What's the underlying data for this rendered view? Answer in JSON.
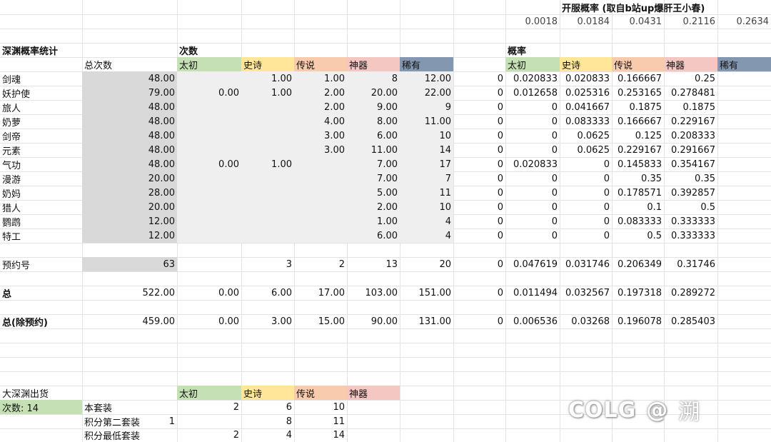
{
  "colors": {
    "grid": "#e3e3e3",
    "gray_block": "#d9d9d9",
    "light_block": "#efefef",
    "green": "#c5e0b4",
    "yellow": "#ffe699",
    "orange": "#f8cbad",
    "pink": "#f4c7c3",
    "blue_gray": "#8497b0"
  },
  "open_rate": {
    "title": "开服概率   (取自b站up爆肝王小春)",
    "values": [
      "0.0018",
      "0.0184",
      "0.0431",
      "0.2116",
      "0.2634"
    ]
  },
  "stats_title": "深渊概率统计",
  "count_title": "次数",
  "prob_title": "概率",
  "total_count_header": "总次数",
  "grade_headers": [
    "太初",
    "史诗",
    "传说",
    "神器",
    "稀有"
  ],
  "rows": [
    {
      "name": "剑魂",
      "total": "48.00",
      "counts": [
        "",
        "1.00",
        "1.00",
        "8",
        "12.00"
      ],
      "probs": [
        "0",
        "0.020833",
        "0.020833",
        "0.166667",
        "0.25"
      ]
    },
    {
      "name": "妖护使",
      "total": "79.00",
      "counts": [
        "0.00",
        "1.00",
        "2.00",
        "20.00",
        "22.00"
      ],
      "probs": [
        "0",
        "0.012658",
        "0.025316",
        "0.253165",
        "0.278481"
      ]
    },
    {
      "name": "旅人",
      "total": "48.00",
      "counts": [
        "",
        "",
        "2.00",
        "9.00",
        "9"
      ],
      "probs": [
        "0",
        "0",
        "0.041667",
        "0.1875",
        "0.1875"
      ]
    },
    {
      "name": "奶萝",
      "total": "48.00",
      "counts": [
        "",
        "",
        "4.00",
        "8.00",
        "11.00"
      ],
      "probs": [
        "0",
        "0",
        "0.083333",
        "0.166667",
        "0.229167"
      ]
    },
    {
      "name": "剑帝",
      "total": "48.00",
      "counts": [
        "",
        "",
        "3.00",
        "6.00",
        "10"
      ],
      "probs": [
        "0",
        "0",
        "0.0625",
        "0.125",
        "0.208333"
      ]
    },
    {
      "name": "元素",
      "total": "48.00",
      "counts": [
        "",
        "",
        "3.00",
        "11.00",
        "14"
      ],
      "probs": [
        "0",
        "0",
        "0.0625",
        "0.229167",
        "0.291667"
      ]
    },
    {
      "name": "气功",
      "total": "48.00",
      "counts": [
        "0.00",
        "1.00",
        "",
        "7.00",
        "17"
      ],
      "probs": [
        "0",
        "0.020833",
        "0",
        "0.145833",
        "0.354167"
      ]
    },
    {
      "name": "漫游",
      "total": "20.00",
      "counts": [
        "",
        "",
        "",
        "7.00",
        "7"
      ],
      "probs": [
        "0",
        "0",
        "0",
        "0.35",
        "0.35"
      ]
    },
    {
      "name": "奶妈",
      "total": "28.00",
      "counts": [
        "",
        "",
        "",
        "5.00",
        "11"
      ],
      "probs": [
        "0",
        "0",
        "0",
        "0.178571",
        "0.392857"
      ]
    },
    {
      "name": "猎人",
      "total": "20.00",
      "counts": [
        "",
        "",
        "",
        "2.00",
        "10"
      ],
      "probs": [
        "0",
        "0",
        "0",
        "0.1",
        "0.5"
      ]
    },
    {
      "name": "鹦鹉",
      "total": "12.00",
      "counts": [
        "",
        "",
        "",
        "1.00",
        "4"
      ],
      "probs": [
        "0",
        "0",
        "0",
        "0.083333",
        "0.333333"
      ]
    },
    {
      "name": "特工",
      "total": "12.00",
      "counts": [
        "",
        "",
        "",
        "6.00",
        "4"
      ],
      "probs": [
        "0",
        "0",
        "0",
        "0.5",
        "0.333333"
      ]
    }
  ],
  "reservation": {
    "name": "预约号",
    "total": "63",
    "counts": [
      "",
      "3",
      "2",
      "13",
      "20"
    ],
    "probs": [
      "0",
      "0.047619",
      "0.031746",
      "0.206349",
      "0.31746"
    ]
  },
  "total": {
    "name": "总",
    "total": "522.00",
    "counts": [
      "0.00",
      "6.00",
      "17.00",
      "103.00",
      "151.00"
    ],
    "probs": [
      "0",
      "0.011494",
      "0.032567",
      "0.197318",
      "0.289272"
    ]
  },
  "total_ex": {
    "name": "总(除预约)",
    "total": "459.00",
    "counts": [
      "0.00",
      "3.00",
      "15.00",
      "90.00",
      "131.00"
    ],
    "probs": [
      "0",
      "0.006536",
      "0.03268",
      "0.196078",
      "0.285403"
    ]
  },
  "big_abyss": {
    "title": "大深渊出货",
    "count_label": "次数:  14",
    "headers": [
      "太初",
      "史诗",
      "传说",
      "神器"
    ],
    "rows": [
      {
        "label": "本套装",
        "values": [
          "",
          "2",
          "6",
          "10"
        ]
      },
      {
        "label": "积分第二套装",
        "values": [
          "1",
          "",
          "8",
          "11"
        ]
      },
      {
        "label": "积分最低套装",
        "values": [
          "",
          "2",
          "4",
          "14"
        ]
      }
    ]
  },
  "watermark": {
    "logo": "COLG",
    "at": "@",
    "name": "溯"
  }
}
